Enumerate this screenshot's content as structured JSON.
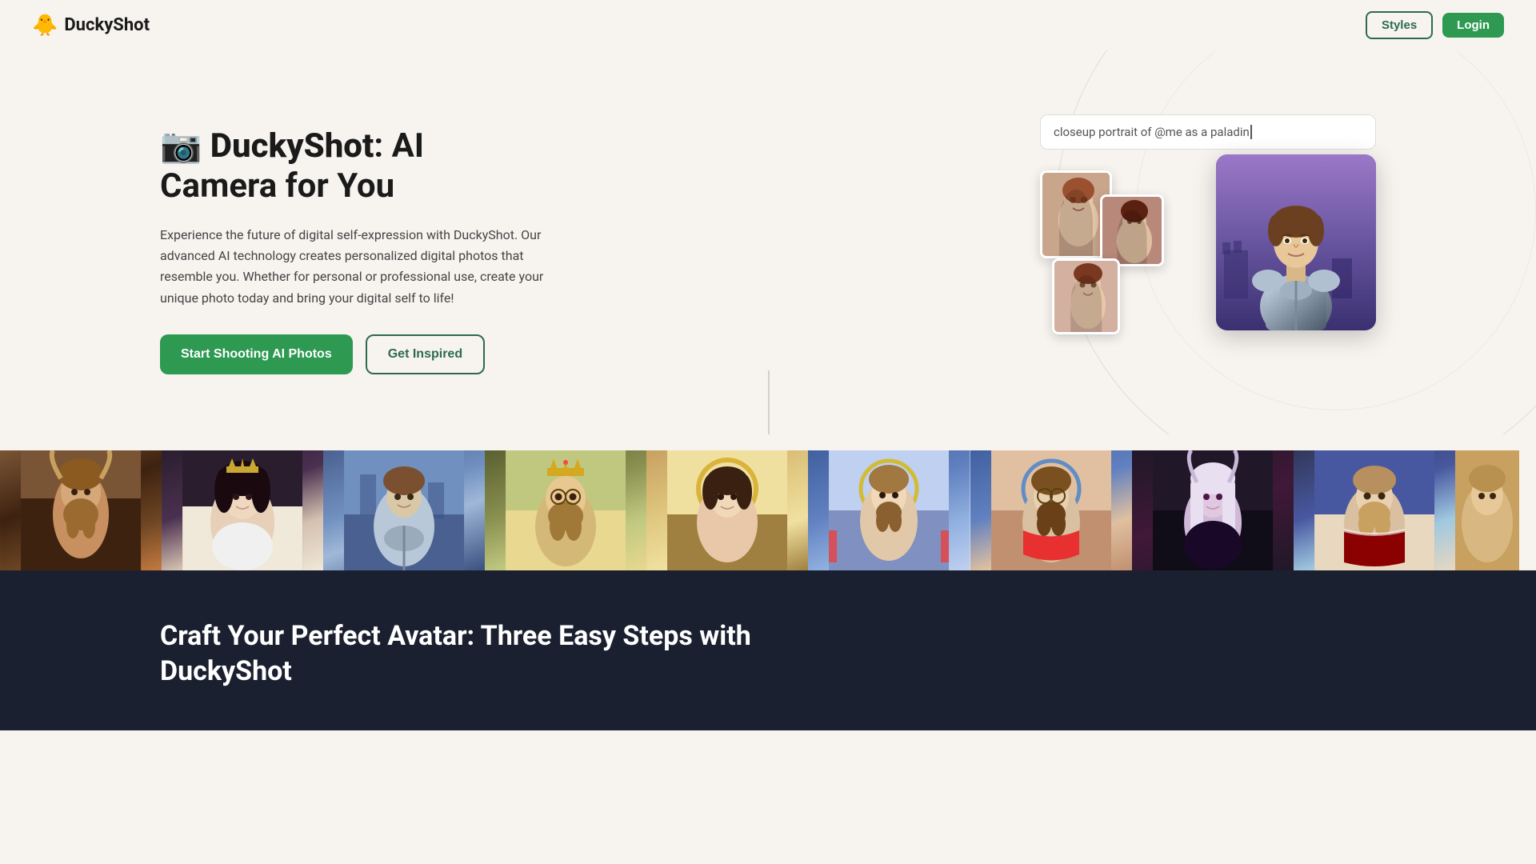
{
  "app": {
    "name": "DuckyShot",
    "logo_icon": "📷",
    "logo_emoji": "🐥"
  },
  "navbar": {
    "logo_text": "DuckyShot",
    "styles_label": "Styles",
    "login_label": "Login"
  },
  "hero": {
    "title_icon": "📷",
    "title_brand": "DuckyShot",
    "title_rest": ": AI Camera for You",
    "description": "Experience the future of digital self-expression with DuckyShot. Our advanced AI technology creates personalized digital photos that resemble you. Whether for personal or professional use, create your unique photo today and bring your digital self to life!",
    "cta_primary": "Start Shooting AI Photos",
    "cta_secondary": "Get Inspired",
    "demo_prompt": "closeup portrait of @me as a paladin"
  },
  "gallery": {
    "items": [
      {
        "id": 1,
        "label": "Viking warrior portrait",
        "class": "gi1"
      },
      {
        "id": 2,
        "label": "Queen with armor",
        "class": "gi2"
      },
      {
        "id": 3,
        "label": "Knight in castle",
        "class": "gi3"
      },
      {
        "id": 4,
        "label": "King with crown",
        "class": "gi4"
      },
      {
        "id": 5,
        "label": "Saint portrait",
        "class": "gi5"
      },
      {
        "id": 6,
        "label": "Saint gold icon",
        "class": "gi6"
      },
      {
        "id": 7,
        "label": "Bearded saint icon",
        "class": "gi7"
      },
      {
        "id": 8,
        "label": "Dark fantasy character",
        "class": "gi8"
      },
      {
        "id": 9,
        "label": "Royal portrait",
        "class": "gi9"
      },
      {
        "id": 10,
        "label": "Fantasy portrait",
        "class": "gi10"
      }
    ]
  },
  "dark_section": {
    "title_line1": "Craft Your Perfect Avatar: Three Easy Steps with",
    "title_line2": "DuckyShot"
  }
}
